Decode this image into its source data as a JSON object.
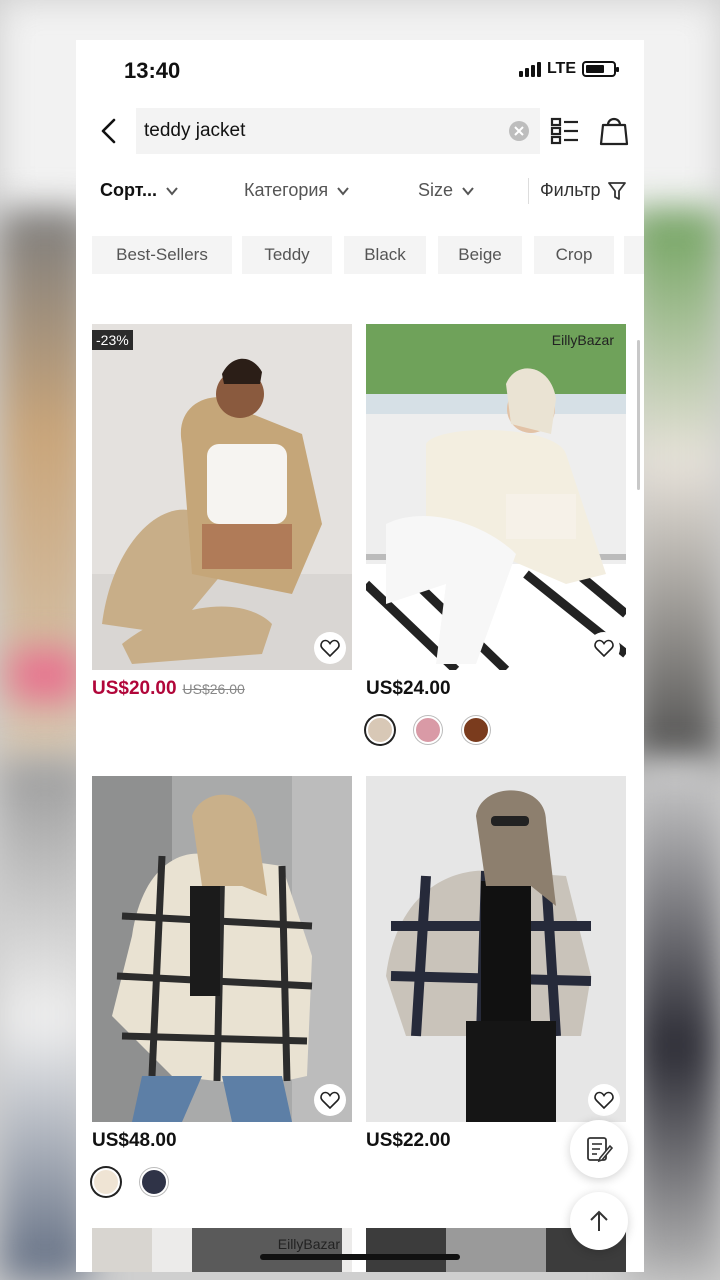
{
  "status": {
    "time": "13:40",
    "network": "LTE"
  },
  "search": {
    "value": "teddy jacket"
  },
  "filters": {
    "sort": "Сорт...",
    "category": "Категория",
    "size": "Size",
    "filter": "Фильтр"
  },
  "chips": [
    "Best-Sellers",
    "Teddy",
    "Black",
    "Beige",
    "Crop"
  ],
  "products": [
    {
      "badge": "-23%",
      "brand": "",
      "price": "US$20.00",
      "old_price": "US$26.00",
      "on_sale": true,
      "swatches": []
    },
    {
      "badge": "",
      "brand": "EillyBazar",
      "price": "US$24.00",
      "old_price": "",
      "on_sale": false,
      "swatches": [
        "#d8c8b6",
        "#d99aa6",
        "#7a3b1d"
      ]
    },
    {
      "badge": "",
      "brand": "",
      "price": "US$48.00",
      "old_price": "",
      "on_sale": false,
      "swatches": [
        "#efe4d4",
        "#2f3347"
      ]
    },
    {
      "badge": "",
      "brand": "",
      "price": "US$22.00",
      "old_price": "",
      "on_sale": false,
      "swatches": []
    },
    {
      "badge": "",
      "brand": "EillyBazar",
      "price": "",
      "old_price": "",
      "on_sale": false,
      "swatches": []
    }
  ],
  "colors": {
    "sale_price": "#b1063a",
    "text": "#111111",
    "chip_bg": "#f4f4f4"
  }
}
